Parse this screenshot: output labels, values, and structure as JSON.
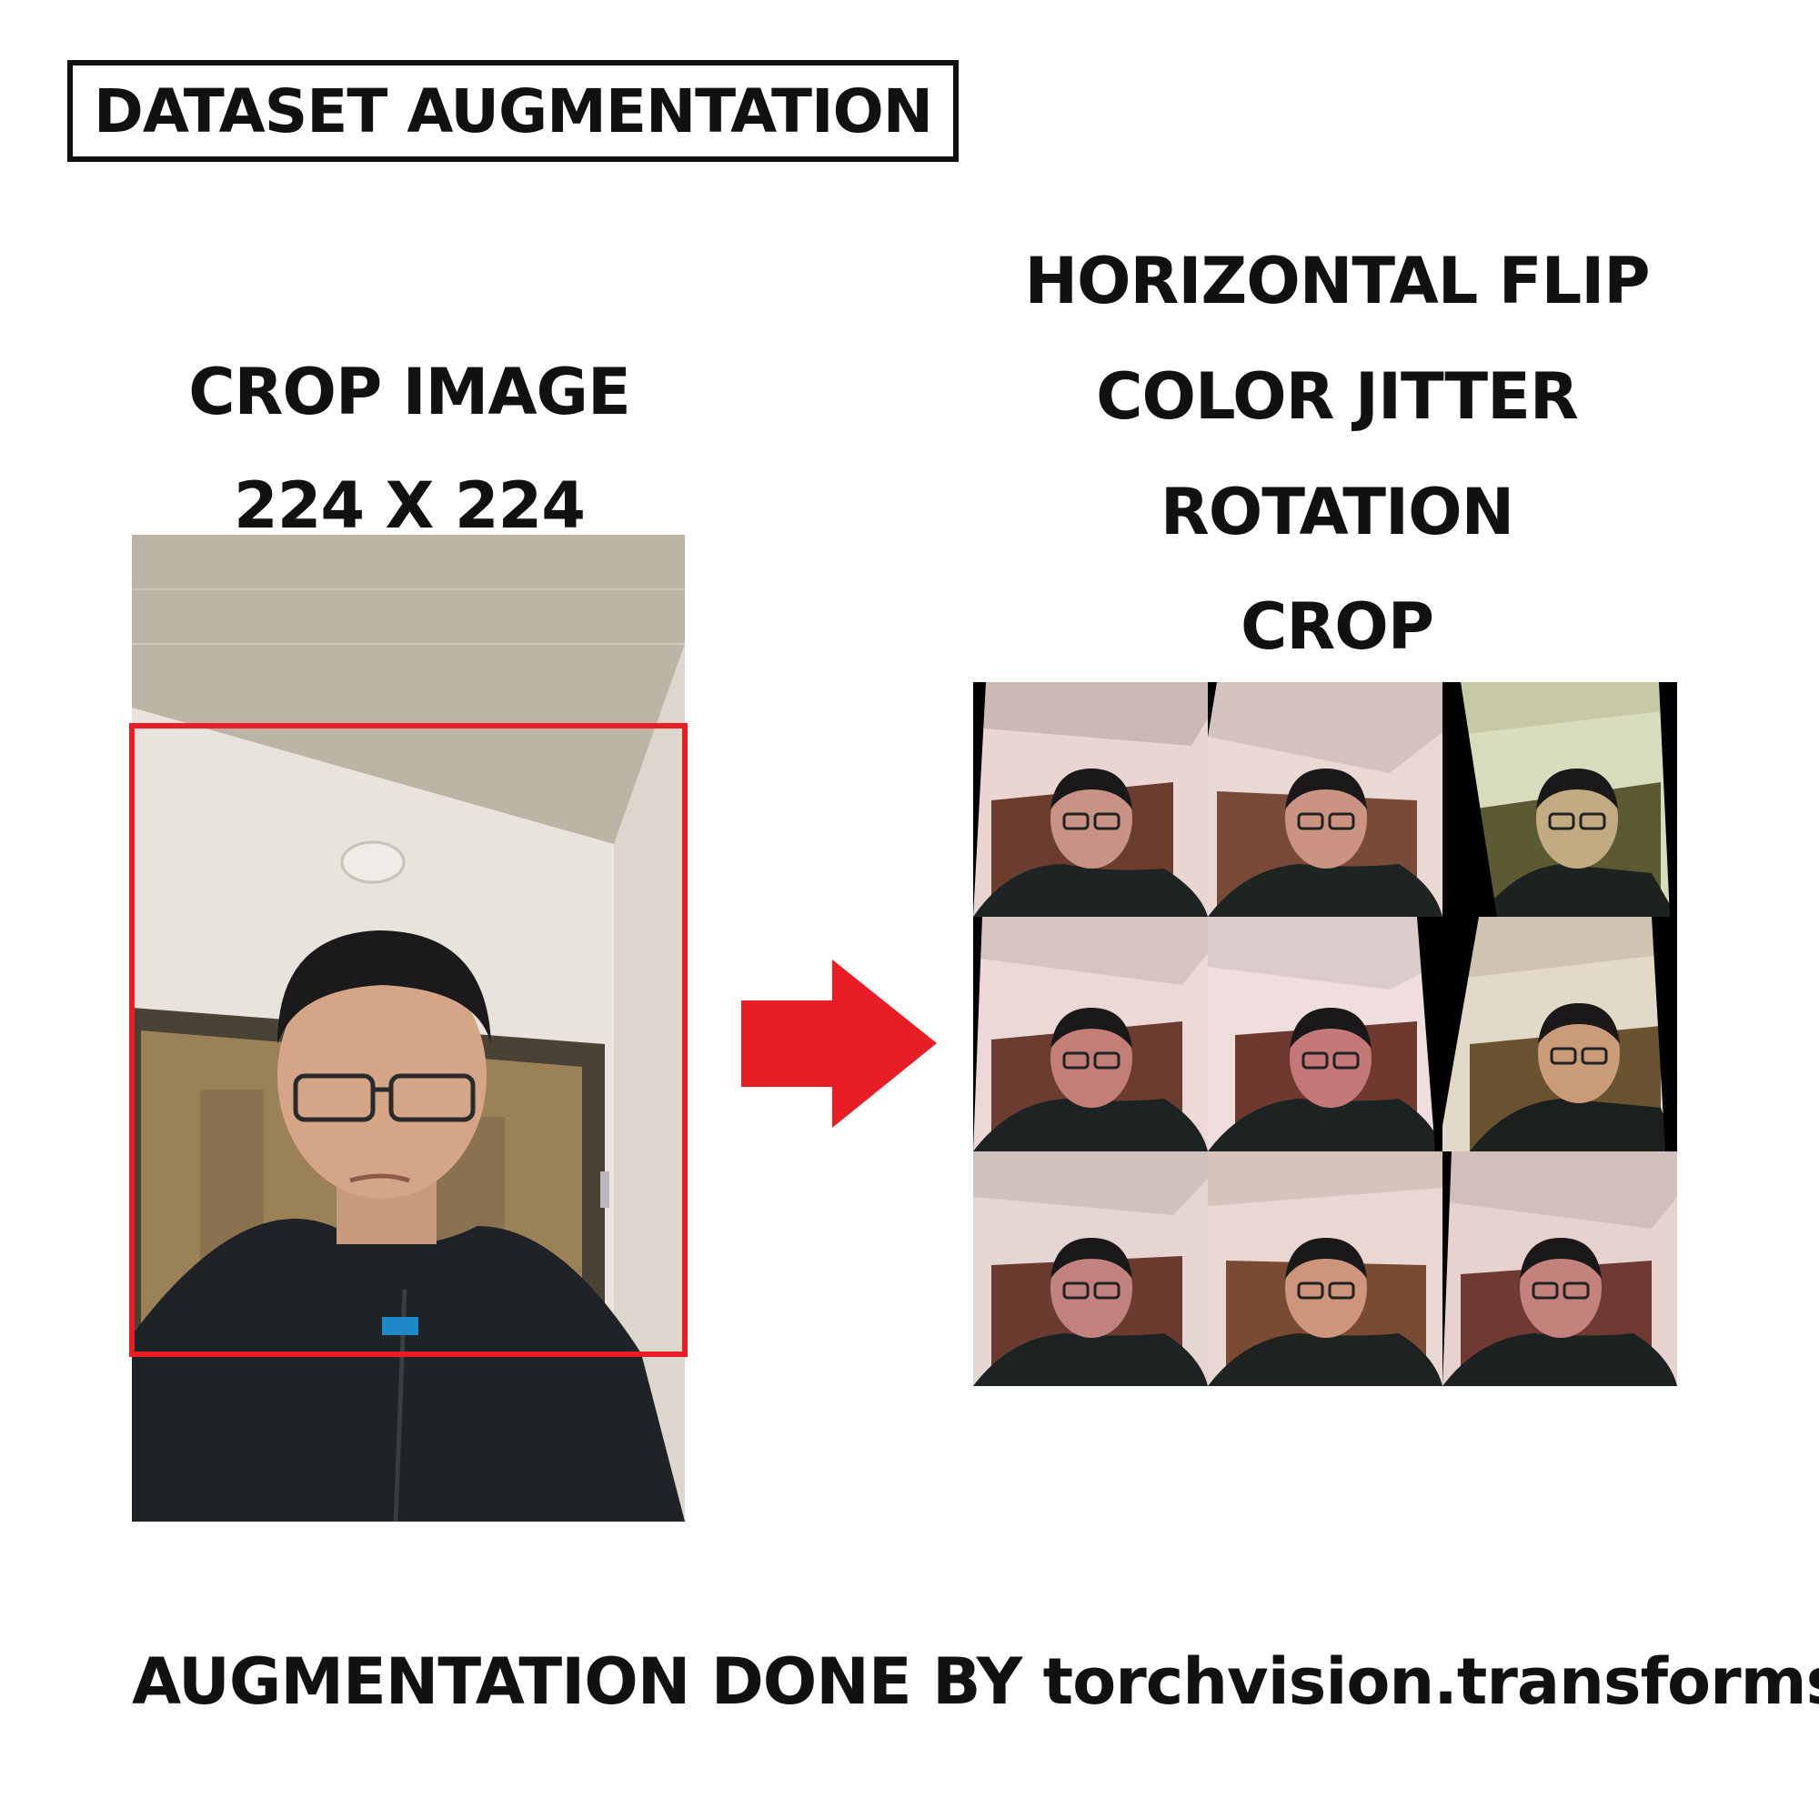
{
  "title": "DATASET AUGMENTATION",
  "left": {
    "label_line1": "CROP IMAGE",
    "label_line2": "224 X 224"
  },
  "right": {
    "transforms": [
      "HORIZONTAL FLIP",
      "COLOR JITTER",
      "ROTATION",
      "CROP"
    ]
  },
  "arrow_icon": "right-arrow-icon",
  "colors": {
    "accent": "#e81d25",
    "text": "#111111"
  },
  "footer": {
    "prefix": "AUGMENTATION DONE BY ",
    "module": "torchvision.transforms"
  }
}
